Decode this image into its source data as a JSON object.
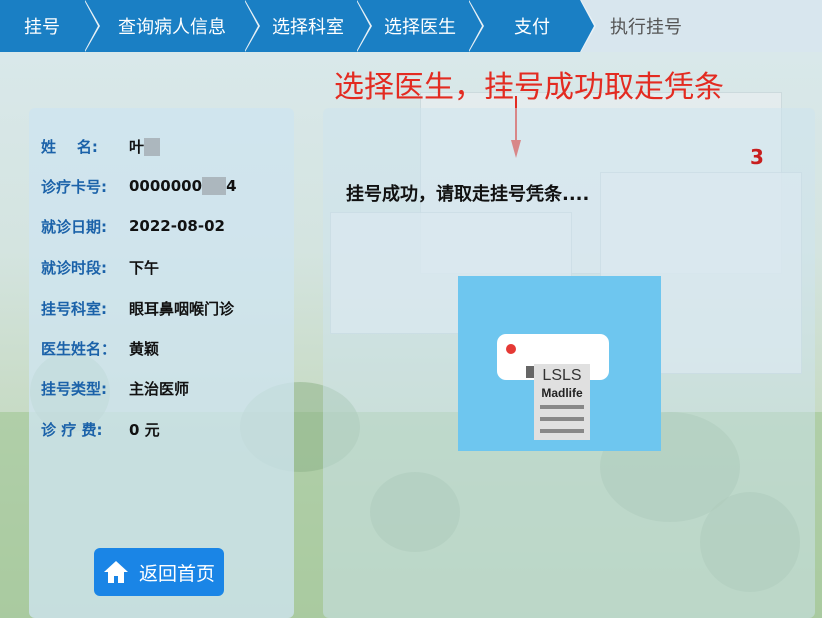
{
  "breadcrumb": {
    "steps": [
      {
        "label": "挂号"
      },
      {
        "label": "查询病人信息"
      },
      {
        "label": "选择科室"
      },
      {
        "label": "选择医生"
      },
      {
        "label": "支付"
      },
      {
        "label": "执行挂号"
      }
    ]
  },
  "banner": "选择医生，挂号成功取走凭条",
  "patient": {
    "fields": [
      {
        "label": "姓    名:",
        "value": "叶"
      },
      {
        "label": "诊疗卡号:",
        "value": "0000000",
        "value_tail": "4"
      },
      {
        "label": "就诊日期:",
        "value": "2022-08-02"
      },
      {
        "label": "就诊时段:",
        "value": "下午"
      },
      {
        "label": "挂号科室:",
        "value": "眼耳鼻咽喉门诊"
      },
      {
        "label": "医生姓名：",
        "value": "黄颖"
      },
      {
        "label": "挂号类型:",
        "value": "主治医师"
      },
      {
        "label": "诊 疗 费:",
        "value": "0 元"
      }
    ]
  },
  "home_button": {
    "label": "返回首页",
    "icon": "home-icon"
  },
  "status": {
    "countdown": "3",
    "message": "挂号成功，请取走挂号凭条...."
  },
  "printer": {
    "icon": "printer-icon",
    "receipt_text_1": "LSLS",
    "receipt_text_2": "Madlife"
  },
  "colors": {
    "accent": "#1a7fc4",
    "banner": "#e32b21",
    "label": "#1b62a9",
    "button": "#1a85e6"
  }
}
